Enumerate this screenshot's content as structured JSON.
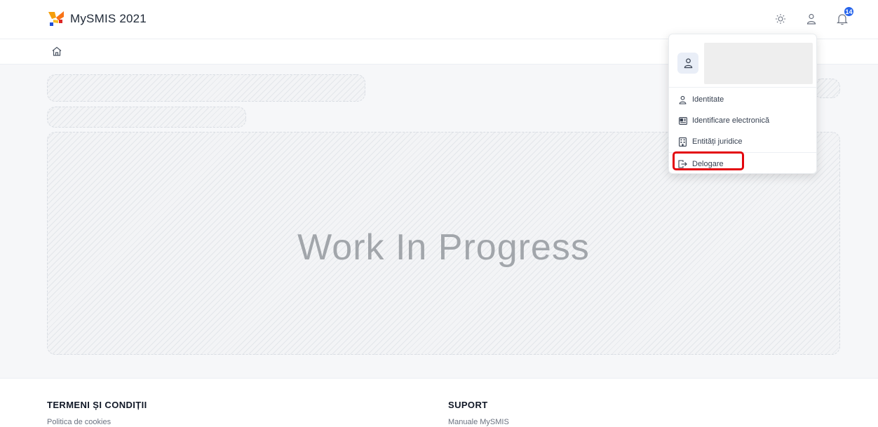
{
  "header": {
    "app_name": "MySMIS 2021",
    "notification_count": "14",
    "icons": [
      "logo-icon",
      "theme-toggle-icon",
      "user-icon",
      "bell-icon"
    ]
  },
  "breadcrumb": {
    "icons": [
      "home-icon"
    ]
  },
  "main": {
    "placeholder_text": "Work In Progress"
  },
  "user_menu": {
    "items": [
      {
        "label": "Identitate",
        "icon": "user-icon"
      },
      {
        "label": "Identificare electronică",
        "icon": "id-card-icon"
      },
      {
        "label": "Entități juridice",
        "icon": "building-icon"
      },
      {
        "label": "Delogare",
        "icon": "logout-icon"
      }
    ]
  },
  "footer": {
    "terms": {
      "title": "TERMENI ȘI CONDIȚII",
      "link": "Politica de cookies"
    },
    "support": {
      "title": "SUPORT",
      "link": "Manuale MySMIS"
    }
  },
  "colors": {
    "accent": "#2563eb",
    "highlight_border": "#e3050d",
    "logo_orange": "#f59e0b",
    "logo_red": "#dc2626",
    "logo_blue": "#1d4ed8"
  }
}
